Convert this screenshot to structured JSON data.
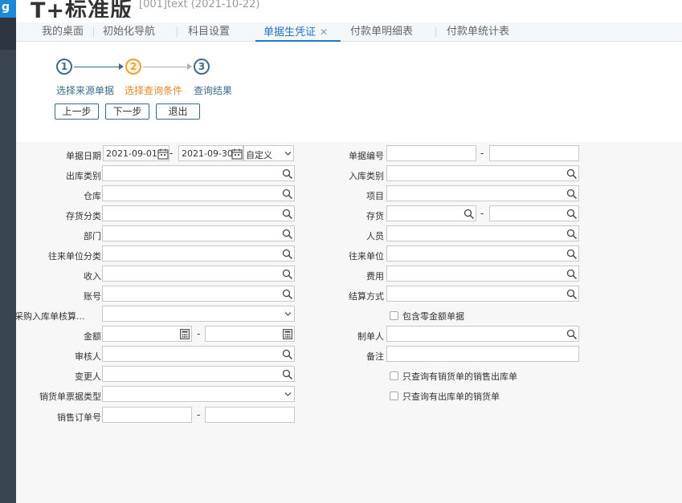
{
  "app": {
    "logo_text": "T+标准版",
    "account_info": "[001]text   (2021-10-22)",
    "side_badge": "g"
  },
  "tabs": [
    {
      "label": "我的桌面"
    },
    {
      "label": "初始化导航"
    },
    {
      "label": "科目设置"
    },
    {
      "label": "单据生凭证",
      "active": true,
      "close": "✕"
    },
    {
      "label": "付款单明细表"
    },
    {
      "label": "付款单统计表"
    }
  ],
  "wizard": {
    "steps": [
      {
        "num": "1",
        "label": "选择来源单据"
      },
      {
        "num": "2",
        "label": "选择查询条件",
        "active": true
      },
      {
        "num": "3",
        "label": "查询结果"
      }
    ],
    "buttons": {
      "prev": "上一步",
      "next": "下一步",
      "exit": "退出"
    }
  },
  "form": {
    "doc_date": {
      "label": "单据日期",
      "from": "2021-09-01",
      "to": "2021-09-30",
      "range": "自定义"
    },
    "dash": "-",
    "doc_no": {
      "label": "单据编号"
    },
    "outbound_type": {
      "label": "出库类别"
    },
    "inbound_type": {
      "label": "入库类别"
    },
    "warehouse": {
      "label": "仓库"
    },
    "project": {
      "label": "项目"
    },
    "inventory_category": {
      "label": "存货分类"
    },
    "inventory": {
      "label": "存货"
    },
    "department": {
      "label": "部门"
    },
    "staff": {
      "label": "人员"
    },
    "partner_category": {
      "label": "往来单位分类"
    },
    "partner": {
      "label": "往来单位"
    },
    "income": {
      "label": "收入"
    },
    "expense": {
      "label": "费用"
    },
    "account": {
      "label": "账号"
    },
    "settlement": {
      "label": "结算方式"
    },
    "purchase_check": {
      "label": "采购入库单核算..."
    },
    "include_zero": {
      "label": "包含零金额单据"
    },
    "amount": {
      "label": "金额"
    },
    "creator": {
      "label": "制单人"
    },
    "reviewer": {
      "label": "审核人"
    },
    "remark": {
      "label": "备注"
    },
    "changer": {
      "label": "变更人"
    },
    "only_sales_out": {
      "label": "只查询有销货单的销售出库单"
    },
    "sales_invoice_type": {
      "label": "销货单票据类型"
    },
    "only_out_sales": {
      "label": "只查询有出库单的销货单"
    },
    "sales_order_no": {
      "label": "销售订单号"
    }
  },
  "colors": {
    "accent": "#2574c4",
    "active_step": "#e6a23c",
    "step": "#3e6a8a"
  }
}
